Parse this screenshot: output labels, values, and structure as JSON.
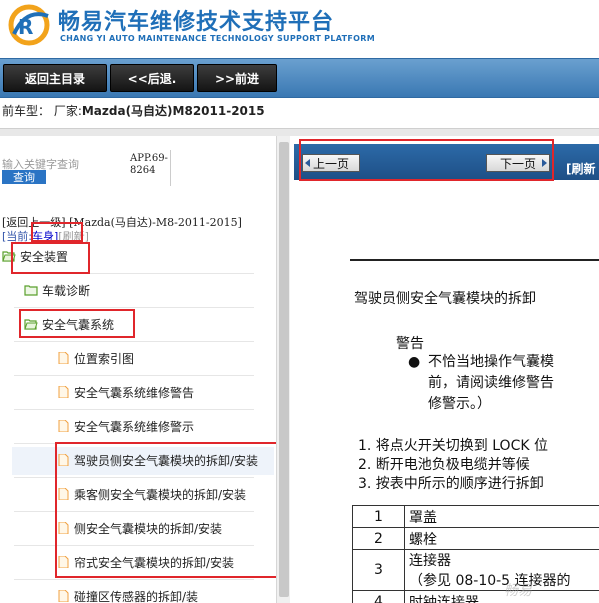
{
  "header": {
    "brand_cn": "畅易汽车维修技术支持平台",
    "brand_en": "CHANG YI AUTO MAINTENANCE TECHNOLOGY SUPPORT PLATFORM",
    "brand_color": "#1f6fb8",
    "logo_icon": "cy-logo-icon"
  },
  "nav": {
    "main_menu": "返回主目录",
    "back": "<<后退.",
    "forward": ">>前进"
  },
  "current_model": {
    "prefix": "前车型：  厂家:",
    "value": "Mazda(马自达)M82011-2015"
  },
  "left": {
    "search_placeholder": "输入关键字查询",
    "search_button": "查询",
    "app_code": "APP.69-8264",
    "back_line": "[返回上一级]  [Mazda(马自达)-M8-2011-2015]",
    "crumb_current": "[当前:",
    "crumb_car": "车身]",
    "crumb_refresh": "[刷新]",
    "tree": [
      {
        "label": "安全装置",
        "type": "folder-open"
      },
      {
        "label": "车载诊断",
        "type": "folder"
      },
      {
        "label": "安全气囊系统",
        "type": "folder-open"
      },
      {
        "label": "位置索引图",
        "type": "doc"
      },
      {
        "label": "安全气囊系统维修警告",
        "type": "doc"
      },
      {
        "label": "安全气囊系统维修警示",
        "type": "doc"
      },
      {
        "label": "驾驶员侧安全气囊模块的拆卸/安装",
        "type": "doc"
      },
      {
        "label": "乘客侧安全气囊模块的拆卸/安装",
        "type": "doc"
      },
      {
        "label": "侧安全气囊模块的拆卸/安装",
        "type": "doc"
      },
      {
        "label": "帘式安全气囊模块的拆卸/安装",
        "type": "doc"
      },
      {
        "label": "碰撞区传感器的拆卸/装",
        "type": "doc"
      }
    ]
  },
  "right": {
    "prev_page": "上一页",
    "next_page": "下一页",
    "refresh": "[刷新",
    "doc_title": "驾驶员侧安全气囊模块的拆卸",
    "warning_title": "警告",
    "warning_lines": [
      "不恰当地操作气囊模",
      "前，请阅读维修警告",
      "修警示。）"
    ],
    "steps": [
      "1.  将点火开关切换到 LOCK 位",
      "2.  断开电池负极电缆并等候",
      "3.  按表中所示的顺序进行拆卸"
    ],
    "table": [
      {
        "n": "1",
        "item": "罩盖"
      },
      {
        "n": "2",
        "item": "螺栓"
      },
      {
        "n": "3",
        "item": "连接器",
        "sub": "（参见 08-10-5 连接器的"
      },
      {
        "n": "4",
        "item": "时钟连接器"
      }
    ]
  },
  "watermark": "畅易",
  "colors": {
    "nav_blue": "#3a78b3",
    "highlight_red": "#e0262b",
    "folder_green": "#5aa02c",
    "doc_orange": "#f0a040"
  }
}
